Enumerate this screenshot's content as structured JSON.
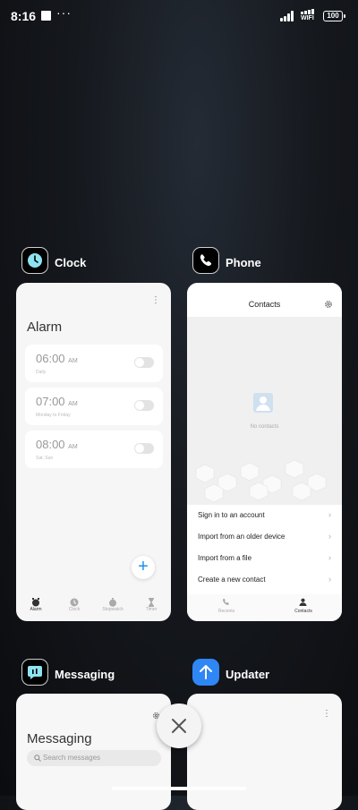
{
  "status_bar": {
    "time": "8:16",
    "more": "···",
    "wifi_label": "WIFI",
    "battery": "100"
  },
  "apps": [
    {
      "name": "Clock",
      "screen": {
        "title": "Alarm",
        "alarms": [
          {
            "time": "06:00",
            "ampm": "AM",
            "sub": "Daily"
          },
          {
            "time": "07:00",
            "ampm": "AM",
            "sub": "Monday to Friday"
          },
          {
            "time": "08:00",
            "ampm": "AM",
            "sub": "Sat, Sun"
          }
        ],
        "nav": [
          "Alarm",
          "Clock",
          "Stopwatch",
          "Timer"
        ]
      }
    },
    {
      "name": "Phone",
      "screen": {
        "title": "Contacts",
        "empty": "No contacts",
        "options": [
          "Sign in to an account",
          "Import from an older device",
          "Import from a file",
          "Create a new contact"
        ],
        "nav": [
          "Recents",
          "Contacts"
        ]
      }
    },
    {
      "name": "Messaging",
      "screen": {
        "title": "Messaging",
        "search_placeholder": "Search messages"
      }
    },
    {
      "name": "Updater"
    }
  ],
  "colors": {
    "accent_blue": "#1e8ef0",
    "updater_blue": "#2f86f5"
  }
}
